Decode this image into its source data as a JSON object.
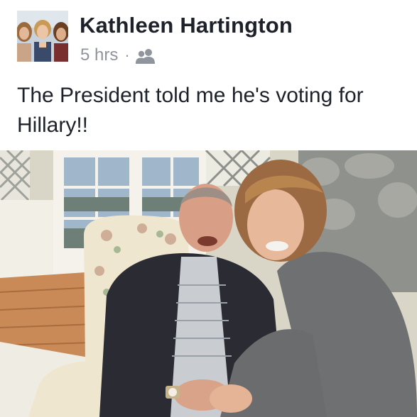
{
  "post": {
    "author": "Kathleen Hartington",
    "timestamp": "5 hrs",
    "separator": "·",
    "audience_icon": "friends-icon",
    "message": "The President told me he's voting for Hillary!!"
  },
  "photo": {
    "subject_icon": "post-photo"
  },
  "colors": {
    "meta": "#90949c",
    "text": "#1d2129"
  }
}
